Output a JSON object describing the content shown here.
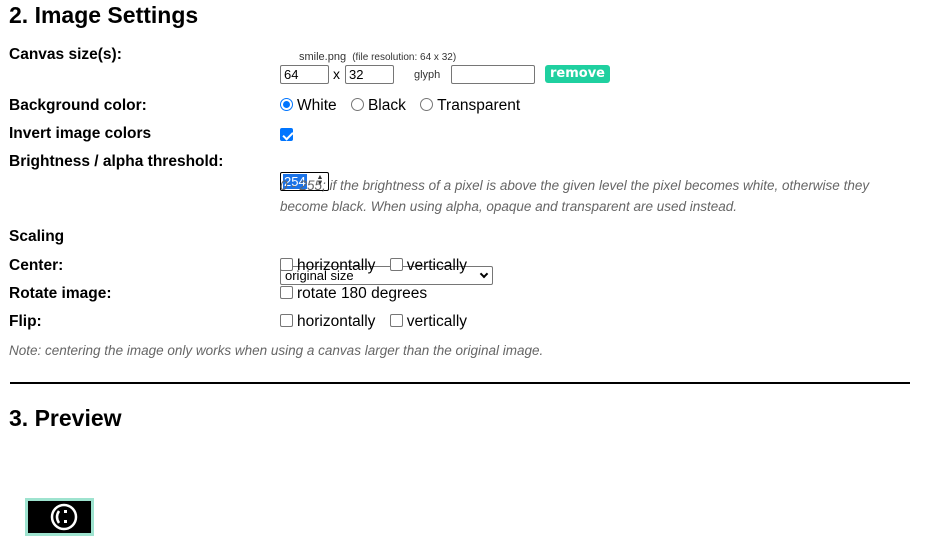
{
  "section2": {
    "title": "2. Image Settings"
  },
  "canvas": {
    "label": "Canvas size(s):",
    "filename": "smile.png",
    "resolution": "(file resolution: 64 x 32)",
    "width": "64",
    "x_sep": "x",
    "height": "32",
    "glyph_label": "glyph",
    "glyph_value": "",
    "remove_label": "remove"
  },
  "background": {
    "label": "Background color:",
    "options": [
      "White",
      "Black",
      "Transparent"
    ],
    "selected": "White"
  },
  "invert": {
    "label": "Invert image colors",
    "checked": true
  },
  "brightness": {
    "label": "Brightness / alpha threshold:",
    "value": "254",
    "help_line1": "0 - 255; if the brightness of a pixel is above the given level the pixel becomes white, otherwise they",
    "help_line2": "become black. When using alpha, opaque and transparent are used instead."
  },
  "scaling": {
    "label": "Scaling",
    "selected": "original size"
  },
  "center": {
    "label": "Center:",
    "horizontal": "horizontally",
    "vertical": "vertically"
  },
  "rotate": {
    "label": "Rotate image:",
    "option": "rotate 180 degrees"
  },
  "flip": {
    "label": "Flip:",
    "horizontal": "horizontally",
    "vertical": "vertically"
  },
  "note": "Note: centering the image only works when using a canvas larger than the original image.",
  "section3": {
    "title": "3. Preview"
  },
  "colors": {
    "accent": "#0075ff",
    "remove_button": "#1fd0a0",
    "preview_border": "#9ee3cf"
  }
}
